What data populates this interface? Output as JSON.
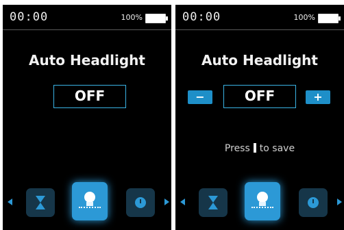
{
  "screens": [
    {
      "status": {
        "time": "00:00",
        "battery": "100%"
      },
      "title": "Auto Headlight",
      "value": "OFF",
      "icons": [
        "hourglass-icon",
        "headlight-icon",
        "gauge-icon"
      ]
    },
    {
      "status": {
        "time": "00:00",
        "battery": "100%"
      },
      "title": "Auto Headlight",
      "value": "OFF",
      "minus_label": "−",
      "plus_label": "+",
      "hint_before": "Press",
      "hint_after": "to save",
      "icons": [
        "hourglass-icon",
        "headlight-icon",
        "gauge-icon"
      ]
    }
  ],
  "colors": {
    "accent": "#2c99d6",
    "background": "#000000",
    "icon_button": "#163649"
  }
}
